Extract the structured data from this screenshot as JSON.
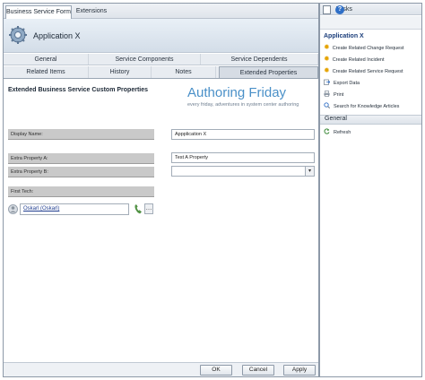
{
  "form": {
    "top_tabs": [
      "Business Service Form",
      "Extensions"
    ],
    "app_title": "Application X",
    "sub_tabs_row1": [
      "General",
      "Service Components",
      "Service Dependents"
    ],
    "sub_tabs_row2": [
      "Related Items",
      "History",
      "Notes",
      "Extended Properties"
    ],
    "active_sub_tab": "Extended Properties",
    "section_title": "Extended Business Service Custom Properties",
    "brand_title": "Authoring Friday",
    "brand_subtitle": "every friday, adventures in system center authoring",
    "fields": {
      "display_name_label": "Display Name:",
      "display_name_value": "Appplication X",
      "extra_a_label": "Extra Property A:",
      "extra_a_value": "Test A Property",
      "extra_b_label": "Extra Property B:",
      "extra_b_value": "",
      "first_tech_label": "First Tech:",
      "first_tech_value": "Oskarl (Oskarl)"
    },
    "buttons": {
      "ok": "OK",
      "cancel": "Cancel",
      "apply": "Apply"
    }
  },
  "tasks": {
    "header": "Tasks",
    "group_title": "Application X",
    "items": [
      "Create Related Change Request",
      "Create Related Incident",
      "Create Related Service Request",
      "Export Data",
      "Print",
      "Search for Knowledge Articles"
    ],
    "general_title": "General",
    "general_items": [
      "Refresh"
    ],
    "help_glyph": "?"
  },
  "colors": {
    "accent": "#4a90c8",
    "link": "#1f3d8f",
    "group_title": "#1a3d7a"
  }
}
